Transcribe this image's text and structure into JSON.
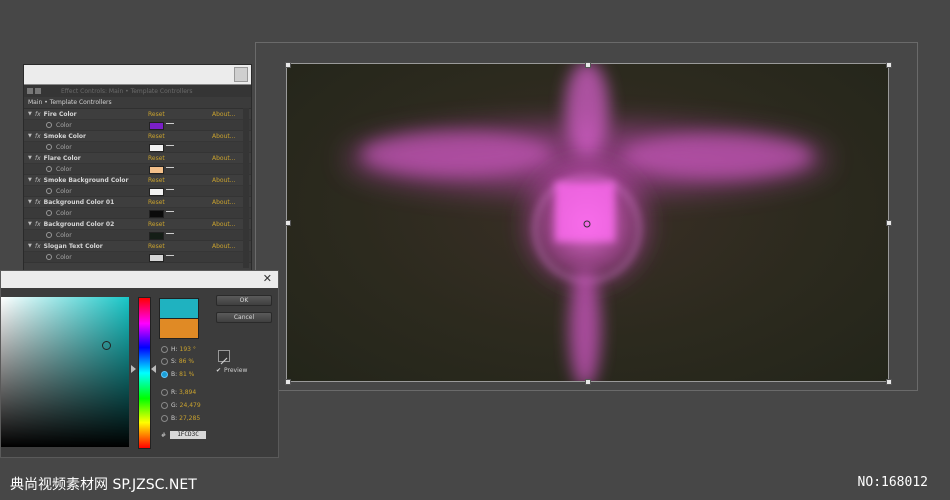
{
  "effect_controls": {
    "tab_label": "Effect Controls: Main • Template Controllers",
    "breadcrumb": "Main • Template Controllers",
    "effects": [
      {
        "name": "Fire Color",
        "reset": "Reset",
        "about": "About...",
        "prop": "Color",
        "swatch": "#7a1fc8"
      },
      {
        "name": "Smoke Color",
        "reset": "Reset",
        "about": "About...",
        "prop": "Color",
        "swatch": "#f2f2f2"
      },
      {
        "name": "Flare Color",
        "reset": "Reset",
        "about": "About...",
        "prop": "Color",
        "swatch": "#f4c08a"
      },
      {
        "name": "Smoke Background Color",
        "reset": "Reset",
        "about": "About...",
        "prop": "Color",
        "swatch": "#f2f2f2"
      },
      {
        "name": "Background Color 01",
        "reset": "Reset",
        "about": "About...",
        "prop": "Color",
        "swatch": "#0b0b0b"
      },
      {
        "name": "Background Color 02",
        "reset": "Reset",
        "about": "About...",
        "prop": "Color",
        "swatch": "#151e17"
      },
      {
        "name": "Slogan Text Color",
        "reset": "Reset",
        "about": "About...",
        "prop": "Color",
        "swatch": "#d6d6d6"
      }
    ]
  },
  "color_picker": {
    "ok_label": "OK",
    "cancel_label": "Cancel",
    "preview_label": "Preview",
    "preview_checked": true,
    "fields": [
      {
        "label": "H:",
        "value": "193 °",
        "selected": false
      },
      {
        "label": "S:",
        "value": "86 %",
        "selected": false
      },
      {
        "label": "B:",
        "value": "81 %",
        "selected": true
      },
      {
        "label": "R:",
        "value": "3,894",
        "selected": false
      },
      {
        "label": "G:",
        "value": "24,479",
        "selected": false
      },
      {
        "label": "B:",
        "value": "27,285",
        "selected": false
      }
    ],
    "hex_prefix": "#",
    "hex": "1FCD3C",
    "new_color": "#1fb2c0",
    "old_color": "#e08a25"
  },
  "watermark": {
    "left": "典尚视频素材网 SP.JZSC.NET",
    "right": "NO:168012"
  }
}
